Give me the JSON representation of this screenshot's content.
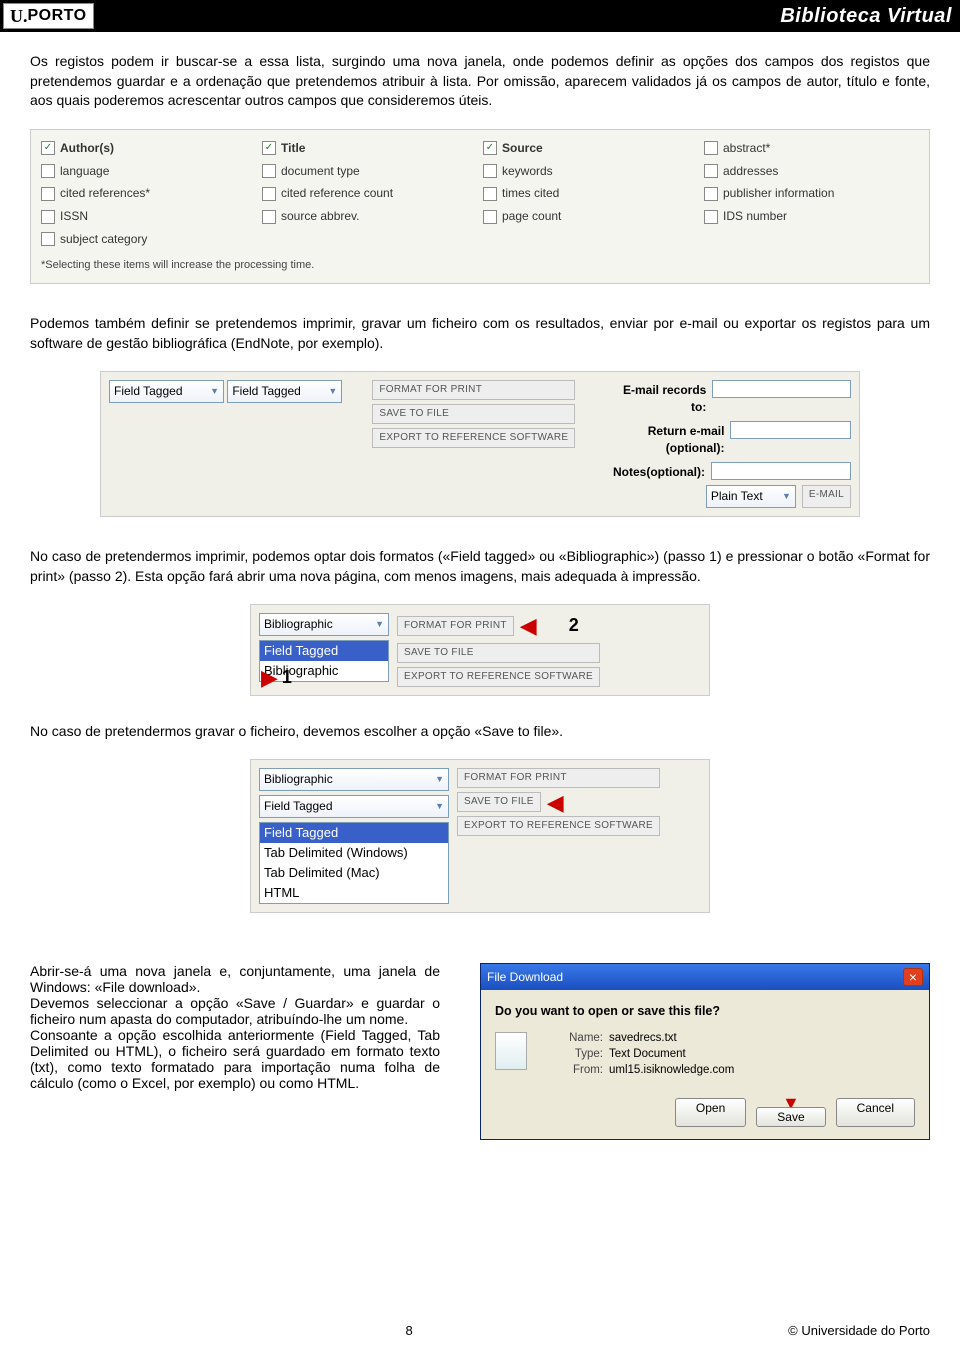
{
  "header": {
    "logo_u": "U.",
    "logo_porto": "PORTO",
    "title": "Biblioteca Virtual"
  },
  "p1": "Os registos podem ir buscar-se a essa lista, surgindo uma nova janela, onde podemos definir as opções dos campos dos registos que pretendemos guardar e a ordenação que pretendemos atribuir à lista. Por omissão, aparecem validados já os campos de autor, título e fonte, aos quais poderemos acrescentar outros campos que consideremos úteis.",
  "checks": {
    "c": [
      {
        "l": "Author(s)",
        "on": true
      },
      {
        "l": "Title",
        "on": true
      },
      {
        "l": "Source",
        "on": true
      },
      {
        "l": "abstract*",
        "on": false
      },
      {
        "l": "language",
        "on": false
      },
      {
        "l": "document type",
        "on": false
      },
      {
        "l": "keywords",
        "on": false
      },
      {
        "l": "addresses",
        "on": false
      },
      {
        "l": "cited references*",
        "on": false
      },
      {
        "l": "cited reference count",
        "on": false
      },
      {
        "l": "times cited",
        "on": false
      },
      {
        "l": "publisher information",
        "on": false
      },
      {
        "l": "ISSN",
        "on": false
      },
      {
        "l": "source abbrev.",
        "on": false
      },
      {
        "l": "page count",
        "on": false
      },
      {
        "l": "IDS number",
        "on": false
      },
      {
        "l": "subject category",
        "on": false
      }
    ],
    "foot": "*Selecting these items will increase the processing time."
  },
  "p2": "Podemos também definir se pretendemos imprimir, gravar um ficheiro com os resultados, enviar por e-mail ou exportar os registos para um software de gestão bibliográfica (EndNote, por exemplo).",
  "panel2": {
    "sel1": "Field Tagged",
    "sel2": "Field Tagged",
    "b1": "FORMAT FOR PRINT",
    "b2": "SAVE TO FILE",
    "b3": "EXPORT TO REFERENCE SOFTWARE",
    "r1": "E-mail records to:",
    "r2": "Return e-mail (optional):",
    "r3": "Notes(optional):",
    "sel3": "Plain Text",
    "b4": "E-MAIL"
  },
  "p3": "No caso de pretendermos imprimir, podemos optar dois formatos («Field tagged» ou «Bibliographic») (passo 1) e pressionar o botão «Format for print» (passo 2). Esta opção fará abrir uma nova página, com menos imagens, mais adequada à impressão.",
  "panel3": {
    "top": "Bibliographic",
    "opt1": "Field Tagged",
    "opt2": "Bibliographic",
    "b1": "FORMAT FOR PRINT",
    "b2": "SAVE TO FILE",
    "b3": "EXPORT TO REFERENCE SOFTWARE",
    "n1": "1",
    "n2": "2"
  },
  "p4": "No caso de pretendermos gravar o ficheiro, devemos escolher a opção «Save to file».",
  "panel4": {
    "top": "Bibliographic",
    "sel": "Field Tagged",
    "o1": "Field Tagged",
    "o2": "Tab Delimited (Windows)",
    "o3": "Tab Delimited (Mac)",
    "o4": "HTML",
    "b1": "FORMAT FOR PRINT",
    "b2": "SAVE TO FILE",
    "b3": "EXPORT TO REFERENCE SOFTWARE"
  },
  "p5": "Abrir-se-á uma nova janela e, conjuntamente, uma janela de Windows: «File download».",
  "p6": "Devemos seleccionar a opção «Save / Guardar» e guardar o ficheiro num apasta do computador, atribuíndo-lhe um nome.",
  "p7": "Consoante a opção escolhida anteriormente (Field Tagged, Tab Delimited ou HTML), o ficheiro será guardado em formato texto (txt), como texto formatado para importação numa folha de cálculo (como o Excel, por exemplo) ou como HTML.",
  "win": {
    "title": "File Download",
    "q": "Do you want to open or save this file?",
    "kname": "Name:",
    "vname": "savedrecs.txt",
    "ktype": "Type:",
    "vtype": "Text Document",
    "kfrom": "From:",
    "vfrom": "uml15.isiknowledge.com",
    "open": "Open",
    "save": "Save",
    "cancel": "Cancel"
  },
  "footer": {
    "page": "8",
    "copy": "© Universidade do Porto"
  }
}
